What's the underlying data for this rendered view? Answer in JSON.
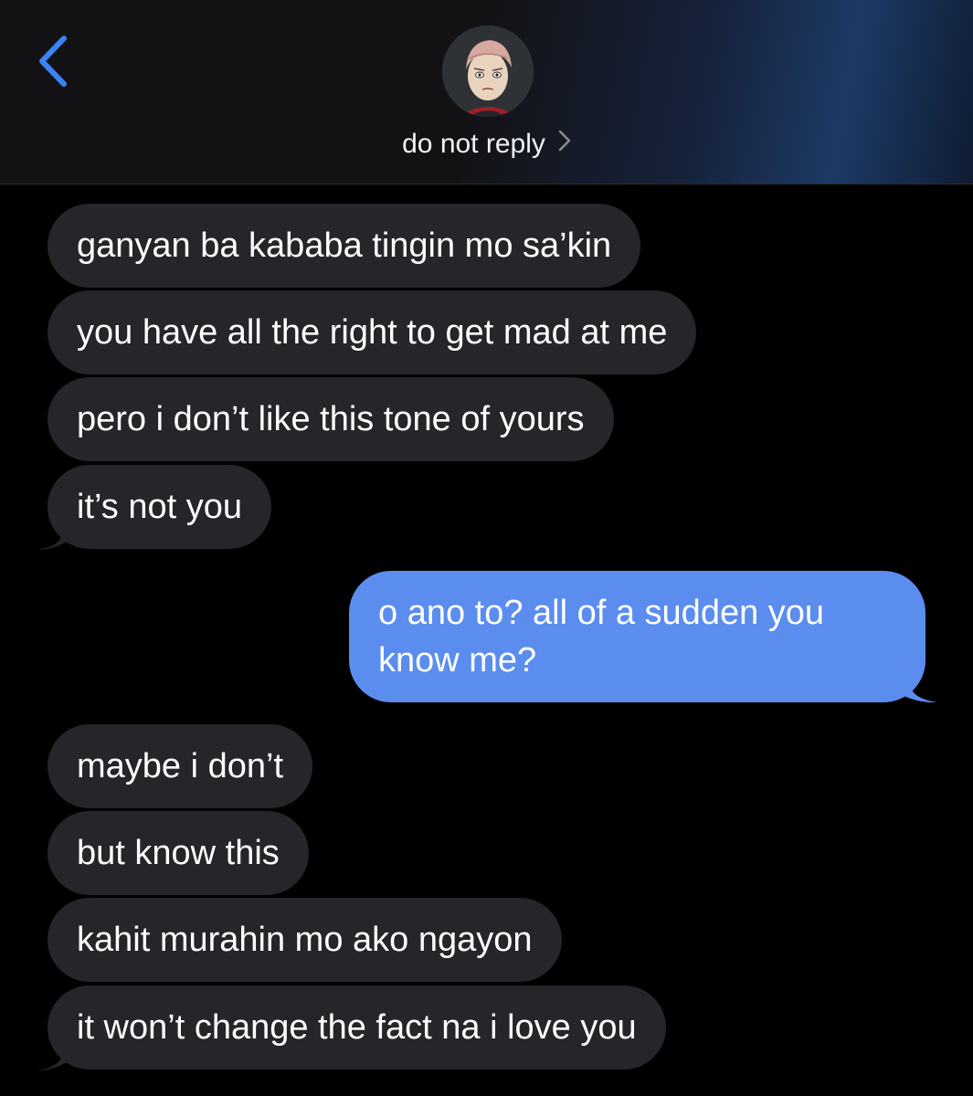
{
  "header": {
    "contact_name": "do not reply",
    "back_icon": "chevron-left-icon",
    "name_chevron_icon": "chevron-right-icon",
    "avatar_icon": "contact-avatar"
  },
  "colors": {
    "background": "#000000",
    "received_bubble": "#26252a",
    "sent_bubble": "#5b8def",
    "accent": "#3b82f6",
    "text": "#ffffff"
  },
  "messages": [
    {
      "direction": "received",
      "text": "ganyan ba kababa tingin mo sa’kin"
    },
    {
      "direction": "received",
      "text": "you have all the right to get mad at me"
    },
    {
      "direction": "received",
      "text": "pero i don’t like this tone of yours"
    },
    {
      "direction": "received",
      "text": "it’s not you"
    },
    {
      "direction": "sent",
      "text": "o ano to? all of a sudden you know me?"
    },
    {
      "direction": "received",
      "text": "maybe i don’t"
    },
    {
      "direction": "received",
      "text": "but know this"
    },
    {
      "direction": "received",
      "text": "kahit murahin mo ako ngayon"
    },
    {
      "direction": "received",
      "text": "it won’t change the fact na i love you"
    }
  ]
}
